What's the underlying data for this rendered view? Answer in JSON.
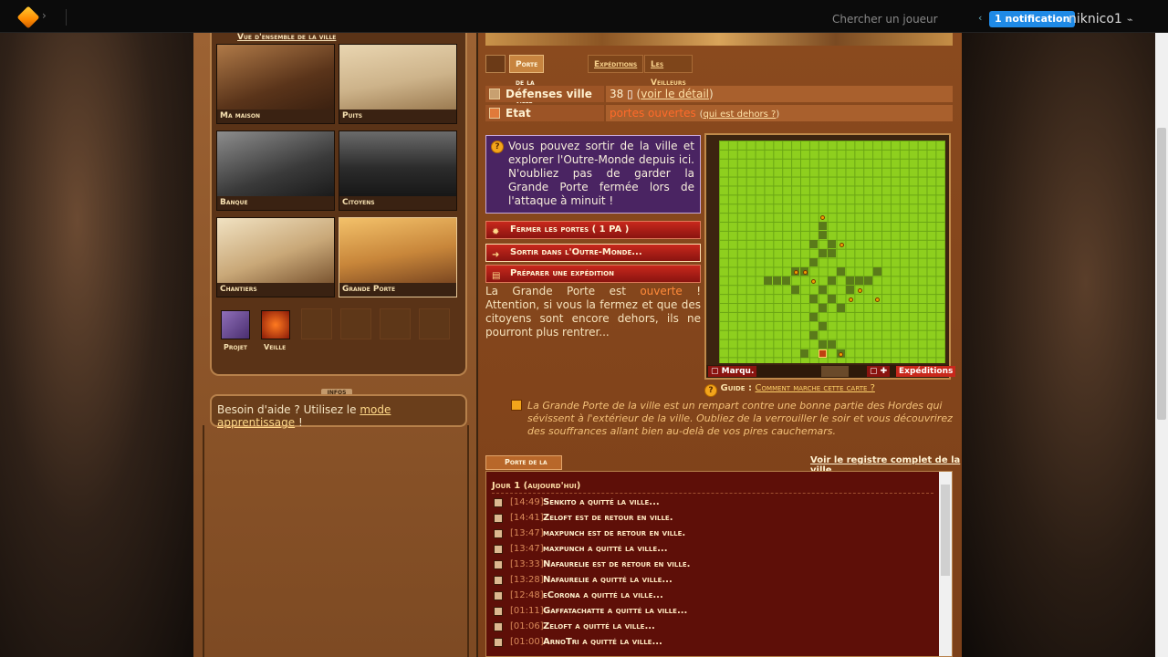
{
  "topbar": {
    "search_placeholder": "Chercher un joueur",
    "notification": "1 notification",
    "username": "niknico1"
  },
  "buildings": {
    "title": "Vue d'ensemble de la ville",
    "tiles": [
      {
        "label": "Ma maison"
      },
      {
        "label": "Puits"
      },
      {
        "label": "Banque"
      },
      {
        "label": "Citoyens"
      },
      {
        "label": "Chantiers"
      },
      {
        "label": "Grande Porte"
      }
    ],
    "small": [
      {
        "label": "Projet"
      },
      {
        "label": "Veille"
      }
    ]
  },
  "infos": {
    "tab": "INFOS",
    "text": "Besoin d'aide ? Utilisez le",
    "link": "mode apprentissage",
    "suffix": "!"
  },
  "tabs": [
    "Porte de la ville",
    "Expéditions",
    "Les Veilleurs"
  ],
  "stats": {
    "defense_label": "Défenses ville",
    "defense_value": "38",
    "defense_link": "voir le détail",
    "state_label": "Etat",
    "state_value": "portes ouvertes",
    "state_link": "qui est dehors ?"
  },
  "info_text": "Vous pouvez sortir de la ville et explorer l'Outre-Monde depuis ici. N'oubliez pas de garder la Grande Porte fermée lors de l'attaque à minuit !",
  "actions": {
    "close": "Fermer les portes ( 1 PA )",
    "go_out": "Sortir dans l'Outre-Monde...",
    "expedition": "Préparer une expédition"
  },
  "desc": {
    "pre": "La Grande Porte est",
    "state": "ouverte",
    "post": "! Attention, si vous la fermez et que des citoyens sont encore dehors, ils ne pourront plus rentrer..."
  },
  "map": {
    "marq": "Marqu.",
    "exp": "Expéditions",
    "guide_label": "Guide :",
    "guide_link": "Comment marche cette carte ?"
  },
  "quote": "La Grande Porte de la ville est un rempart contre une bonne partie des Hordes qui sévissent à l'extérieur de la ville. Oubliez de la verrouiller le soir et vous découvrirez des souffrances allant bien au-delà de vos pires cauchemars.",
  "log": {
    "tab": "Porte de la ville",
    "link": "Voir le registre complet de la ville",
    "day": "Jour 1 (aujourd'hui)",
    "entries": [
      {
        "time": "[14:49]",
        "name": "Senkito",
        "action": "a quitté la ville..."
      },
      {
        "time": "[14:41]",
        "name": "Zeloft",
        "action": "est de retour en ville."
      },
      {
        "time": "[13:47]",
        "name": "maxpunch",
        "action": "est de retour en ville."
      },
      {
        "time": "[13:47]",
        "name": "maxpunch",
        "action": "a quitté la ville..."
      },
      {
        "time": "[13:33]",
        "name": "Nafaurelie",
        "action": "est de retour en ville."
      },
      {
        "time": "[13:28]",
        "name": "Nafaurelie",
        "action": "a quitté la ville..."
      },
      {
        "time": "[12:48]",
        "name": "eCorona",
        "action": "a quitté la ville..."
      },
      {
        "time": "[01:11]",
        "name": "Gaffatachatte",
        "action": "a quitté la ville..."
      },
      {
        "time": "[01:06]",
        "name": "Zeloft",
        "action": "a quitté la ville..."
      },
      {
        "time": "[01:00]",
        "name": "ArnoTri",
        "action": "a quitté la ville..."
      }
    ]
  }
}
